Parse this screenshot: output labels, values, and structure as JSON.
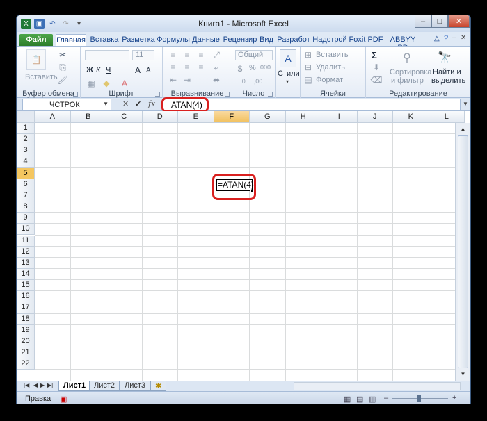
{
  "window": {
    "title": "Книга1 - Microsoft Excel",
    "controls": [
      "–",
      "□",
      "✕"
    ]
  },
  "ribbon_tabs": [
    "Файл",
    "Главная",
    "Вставка",
    "Разметка",
    "Формулы",
    "Данные",
    "Рецензир",
    "Вид",
    "Разработ",
    "Надстрой",
    "Foxit PDF",
    "ABBYY PD"
  ],
  "ribbon": {
    "clipboard": {
      "paste": "Вставить",
      "label": "Буфер обмена"
    },
    "font": {
      "size": "11",
      "bold": "Ж",
      "italic": "К",
      "underline": "Ч",
      "grow": "A",
      "shrink": "A",
      "label": "Шрифт"
    },
    "alignment": {
      "label": "Выравнивание"
    },
    "number": {
      "format": "Общий",
      "percent": "%",
      "thousands": "000",
      "label": "Число"
    },
    "styles": {
      "label": "Стили"
    },
    "cells": {
      "insert": "Вставить",
      "delete": "Удалить",
      "format": "Формат",
      "label": "Ячейки"
    },
    "editing": {
      "sum": "Σ",
      "sort": "Сортировка\nи фильтр",
      "sort1": "Сортировка",
      "sort2": "и фильтр",
      "find1": "Найти и",
      "find2": "выделить",
      "label": "Редактирование"
    }
  },
  "formula_bar": {
    "name_box": "ЧСТРОК",
    "cancel": "✕",
    "enter": "✔",
    "fx": "fx",
    "formula": "=ATAN(4)"
  },
  "grid": {
    "columns": [
      "A",
      "B",
      "C",
      "D",
      "E",
      "F",
      "G",
      "H",
      "I",
      "J",
      "K",
      "L"
    ],
    "rows": [
      "1",
      "2",
      "3",
      "4",
      "5",
      "6",
      "7",
      "8",
      "9",
      "10",
      "11",
      "12",
      "13",
      "14",
      "15",
      "16",
      "17",
      "18",
      "19",
      "20",
      "21",
      "22"
    ],
    "selected_column": "F",
    "selected_row": "5",
    "active_cell_text": "=ATAN(4)"
  },
  "sheets": [
    "Лист1",
    "Лист2",
    "Лист3"
  ],
  "active_sheet": "Лист1",
  "status": {
    "mode": "Правка"
  },
  "colors": {
    "highlight": "#d9201f",
    "selection": "#f4c660",
    "file_tab": "#2d7d2b"
  }
}
